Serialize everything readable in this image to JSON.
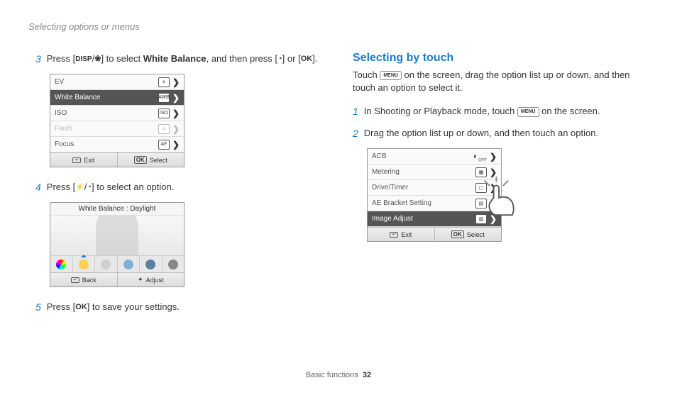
{
  "header": "Selecting options or menus",
  "left": {
    "step3": {
      "num": "3",
      "pre": "Press [",
      "disp": "DISP",
      "slash": "/",
      "post1": "] to select ",
      "wb": "White Balance",
      "post2": ", and then press [",
      "post3": "] or [",
      "ok": "OK",
      "post4": "]."
    },
    "menu1": {
      "rows": [
        {
          "label": "EV",
          "icon": "±"
        },
        {
          "label": "White Balance",
          "icon": "AWB"
        },
        {
          "label": "ISO",
          "icon": "ISO"
        },
        {
          "label": "Flash",
          "icon": "⊘"
        },
        {
          "label": "Focus",
          "icon": "AF"
        }
      ],
      "exit": "Exit",
      "select": "Select",
      "ok": "OK"
    },
    "step4": {
      "num": "4",
      "pre": "Press [",
      "slash": "/",
      "post": "] to select an option."
    },
    "wb_screen": {
      "title": "White Balance : Daylight",
      "back": "Back",
      "adjust": "Adjust"
    },
    "step5": {
      "num": "5",
      "pre": "Press [",
      "ok": "OK",
      "post": "] to save your settings."
    }
  },
  "right": {
    "title": "Selecting by touch",
    "desc1": "Touch ",
    "menu_btn": "MENU",
    "desc2": " on the screen, drag the option list up or down, and then touch an option to select it.",
    "step1": {
      "num": "1",
      "pre": "In Shooting or Playback mode, touch ",
      "post": " on the screen."
    },
    "step2": {
      "num": "2",
      "text": "Drag the option list up or down, and then touch an option."
    },
    "menu2": {
      "rows": [
        {
          "label": "ACB",
          "icon": "◐"
        },
        {
          "label": "Metering",
          "icon": "▦"
        },
        {
          "label": "Drive/Timer",
          "icon": "▢"
        },
        {
          "label": "AE Bracket Setting",
          "icon": "▤"
        },
        {
          "label": "Image Adjust",
          "icon": "▥"
        }
      ],
      "exit": "Exit",
      "select": "Select",
      "ok": "OK"
    }
  },
  "footer": {
    "section": "Basic functions",
    "page": "32"
  }
}
